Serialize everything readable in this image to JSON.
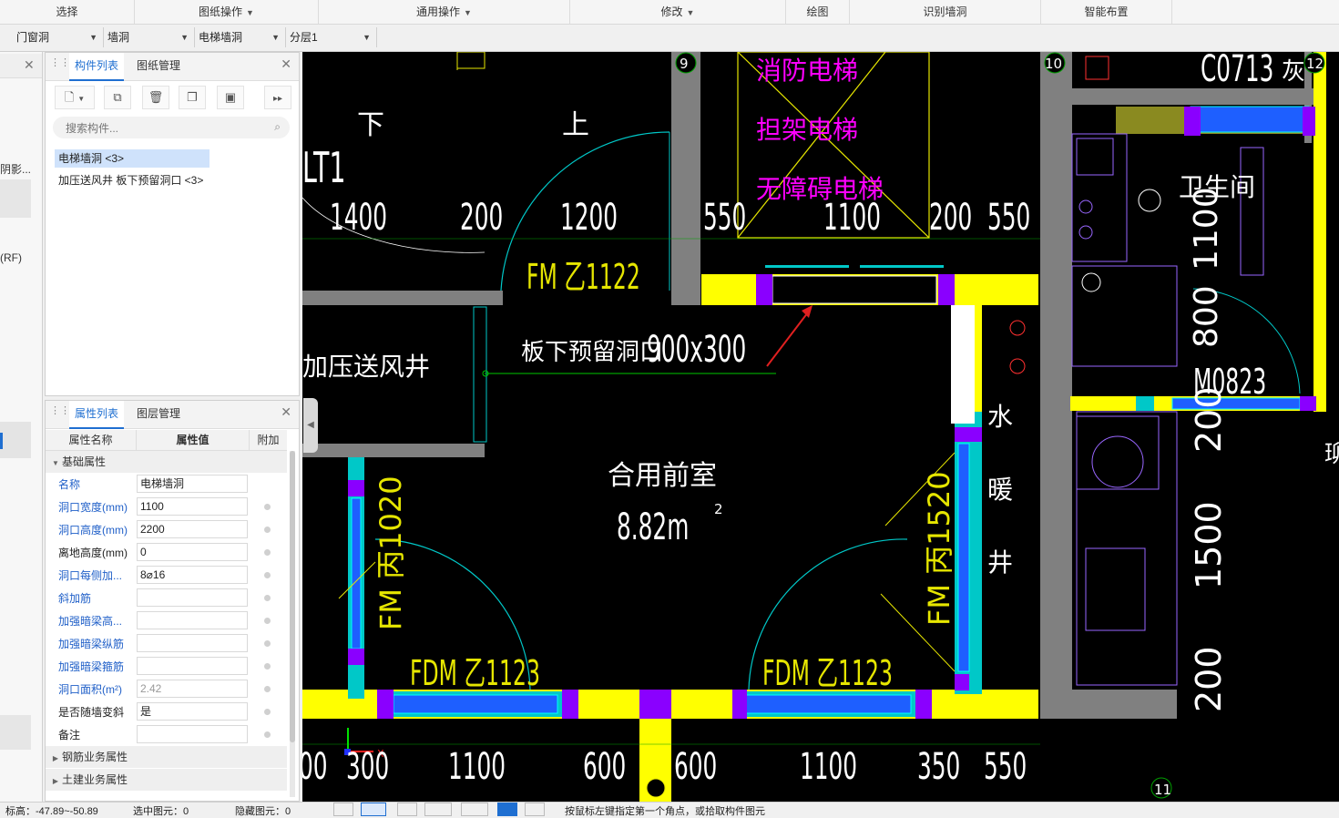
{
  "ribbon": {
    "groups": [
      {
        "label": "选择",
        "caret": false
      },
      {
        "label": "图纸操作",
        "caret": true
      },
      {
        "label": "通用操作",
        "caret": true
      },
      {
        "label": "修改",
        "caret": true
      },
      {
        "label": "绘图",
        "caret": false
      },
      {
        "label": "识别墙洞",
        "caret": false
      },
      {
        "label": "智能布置",
        "caret": false
      }
    ]
  },
  "filters": [
    {
      "value": "门窗洞"
    },
    {
      "value": "墙洞"
    },
    {
      "value": "电梯墙洞"
    },
    {
      "value": "分层1"
    }
  ],
  "leftstrip": {
    "text1": "阴影...",
    "text2": "(RF)"
  },
  "component_panel": {
    "tabs": [
      "构件列表",
      "图纸管理"
    ],
    "search_placeholder": "搜索构件...",
    "items": [
      "电梯墙洞 <3>",
      "加压送风井 板下预留洞口 <3>"
    ]
  },
  "property_panel": {
    "tabs": [
      "属性列表",
      "图层管理"
    ],
    "columns": [
      "属性名称",
      "属性值",
      "附加"
    ],
    "section_basic": "基础属性",
    "rows": [
      {
        "name": "名称",
        "value": "电梯墙洞",
        "blue": true,
        "dot": false,
        "disabled": false
      },
      {
        "name": "洞口宽度(mm)",
        "value": "1100",
        "blue": true,
        "dot": true,
        "disabled": false
      },
      {
        "name": "洞口高度(mm)",
        "value": "2200",
        "blue": true,
        "dot": true,
        "disabled": false
      },
      {
        "name": "离地高度(mm)",
        "value": "0",
        "blue": false,
        "dot": true,
        "disabled": false
      },
      {
        "name": "洞口每侧加...",
        "value": "8⌀16",
        "blue": true,
        "dot": true,
        "disabled": false
      },
      {
        "name": "斜加筋",
        "value": "",
        "blue": true,
        "dot": true,
        "disabled": false
      },
      {
        "name": "加强暗梁高...",
        "value": "",
        "blue": true,
        "dot": true,
        "disabled": false
      },
      {
        "name": "加强暗梁纵筋",
        "value": "",
        "blue": true,
        "dot": true,
        "disabled": false
      },
      {
        "name": "加强暗梁箍筋",
        "value": "",
        "blue": true,
        "dot": true,
        "disabled": false
      },
      {
        "name": "洞口面积(m²)",
        "value": "2.42",
        "blue": true,
        "dot": true,
        "disabled": true
      },
      {
        "name": "是否随墙变斜",
        "value": "是",
        "blue": false,
        "dot": true,
        "disabled": false
      },
      {
        "name": "备注",
        "value": "",
        "blue": false,
        "dot": true,
        "disabled": false
      }
    ],
    "sections_after": [
      "钢筋业务属性",
      "土建业务属性"
    ]
  },
  "drawing": {
    "dims_top": [
      "1400",
      "200",
      "1200",
      "550",
      "1100",
      "200",
      "550"
    ],
    "dims_bottom": [
      "00",
      "300",
      "1100",
      "600",
      "600",
      "1100",
      "350",
      "550"
    ],
    "dims_right": [
      "200",
      "1500",
      "200"
    ],
    "dims_wc": [
      "1100",
      "800"
    ],
    "axis": [
      "9",
      "10",
      "12",
      "11"
    ],
    "texts": {
      "lt1": "LT1",
      "down": "下",
      "up": "上",
      "elev1": "消防电梯",
      "elev2": "担架电梯",
      "elev3": "无障碍电梯",
      "fm1122": "FM 乙1122",
      "opening": "板下预留洞口",
      "opening_size": "900x300",
      "shaft": "加压送风井",
      "lobby": "合用前室",
      "area": "8.82m",
      "area_sup": "2",
      "water1": "水",
      "water2": "暖",
      "water3": "井",
      "fm1020": "FM 丙1020",
      "fm1520": "FM 丙1520",
      "fdm1": "FDM 乙1123",
      "fdm2": "FDM 乙1123",
      "c0713": "C0713",
      "toilet": "卫生间",
      "m0823": "M0823",
      "right_edge_top": "灰",
      "right_edge_mid": "珋"
    }
  },
  "colors": {
    "wall_yellow": "#ffff00",
    "wall_purple": "#8a00ff",
    "wall_cyan": "#00c8c8",
    "wall_gray": "#808080",
    "dim_white": "#ffffff",
    "door_yellow": "#e6e600",
    "magenta": "#ff00ff",
    "arrow_red": "#e02020",
    "ui_blue": "#1f6fd1"
  },
  "status": {
    "elev": "标高：-47.89~-50.89",
    "selected": "选中图元：0",
    "hidden": "隐藏图元：0",
    "hint": "按鼠标左键指定第一个角点，或拾取构件图元"
  }
}
